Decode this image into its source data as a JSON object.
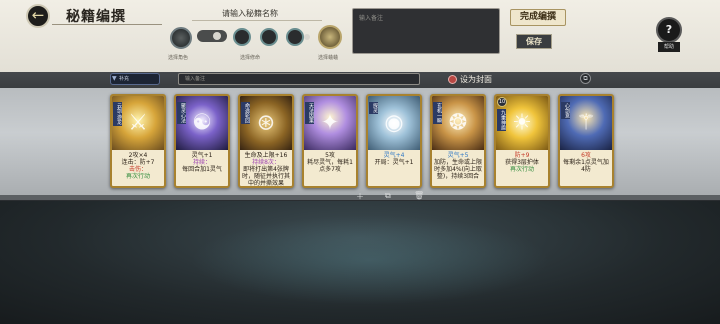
{
  "header": {
    "back_icon": "back-arrow-icon",
    "title": "秘籍编撰",
    "name_prompt": "请输入秘籍名称",
    "slot_labels": {
      "role": "选择角色",
      "cultivation": "选择修命",
      "pet": "选择蛐蛐"
    },
    "note_placeholder": "输入备注",
    "finish_label": "完成编撰",
    "save_label": "保存",
    "help_label": "帮助"
  },
  "toolbar": {
    "tag_label": "补充",
    "note_placeholder": "输入备注",
    "cover_label": "设为封面",
    "copy_icon": "copy-icon"
  },
  "cards": [
    {
      "name": "云剑·游龙",
      "art": "art-gold",
      "glyph": "⚔",
      "cost": "",
      "lines": [
        {
          "t": "2攻×4"
        },
        {
          "t": "连击：防+7"
        },
        {
          "t": "击伤：",
          "c": "hl-red"
        },
        {
          "t": "再次行动",
          "c": "hl-green"
        }
      ]
    },
    {
      "name": "聚灵心法",
      "art": "art-purple",
      "glyph": "☯",
      "cost": "",
      "lines": [
        {
          "t": "灵气+1"
        },
        {
          "t": "持续：",
          "c": "hl-purple"
        },
        {
          "t": "每回合加1灵气"
        }
      ]
    },
    {
      "name": "命途轮回",
      "art": "art-bronze",
      "glyph": "⊛",
      "cost": "",
      "lines": [
        {
          "t": "生命及上限+16"
        },
        {
          "t": "持续8次：",
          "c": "hl-purple"
        },
        {
          "t": "即将打出第4张牌时，随征并执行其中的并撕效果"
        }
      ]
    },
    {
      "name": "天法因果",
      "art": "art-violet",
      "glyph": "✦",
      "cost": "",
      "lines": [
        {
          "t": "5攻"
        },
        {
          "t": "耗尽灵气，每耗1点多7攻"
        }
      ]
    },
    {
      "name": "探灵",
      "art": "art-sky",
      "glyph": "◉",
      "cost": "",
      "lines": [
        {
          "t": "灵气+4",
          "c": "hl-blue"
        },
        {
          "t": "开局：灵气+1"
        }
      ]
    },
    {
      "name": "玄机一瞬",
      "art": "art-amber",
      "glyph": "❂",
      "cost": "",
      "lines": [
        {
          "t": "灵气+5",
          "c": "hl-blue"
        },
        {
          "t": "加防，生命或上限时多加4%(向上取整)，持续3回合"
        }
      ]
    },
    {
      "name": "九重神盾",
      "art": "art-sun",
      "glyph": "☀",
      "cost": "10",
      "lines": [
        {
          "t": "防+9",
          "c": "hl-red"
        },
        {
          "t": "获得3层护体"
        },
        {
          "t": "再次行动",
          "c": "hl-green"
        }
      ]
    },
    {
      "name": "心剑意",
      "art": "art-blue",
      "glyph": "⚚",
      "cost": "",
      "lines": [
        {
          "t": "6攻",
          "c": "hl-red"
        },
        {
          "t": "每剩余1点灵气加4防"
        }
      ]
    }
  ],
  "controls": {
    "add_icon": "plus-icon",
    "dup_icon": "duplicate-icon",
    "del_icon": "trash-icon"
  }
}
